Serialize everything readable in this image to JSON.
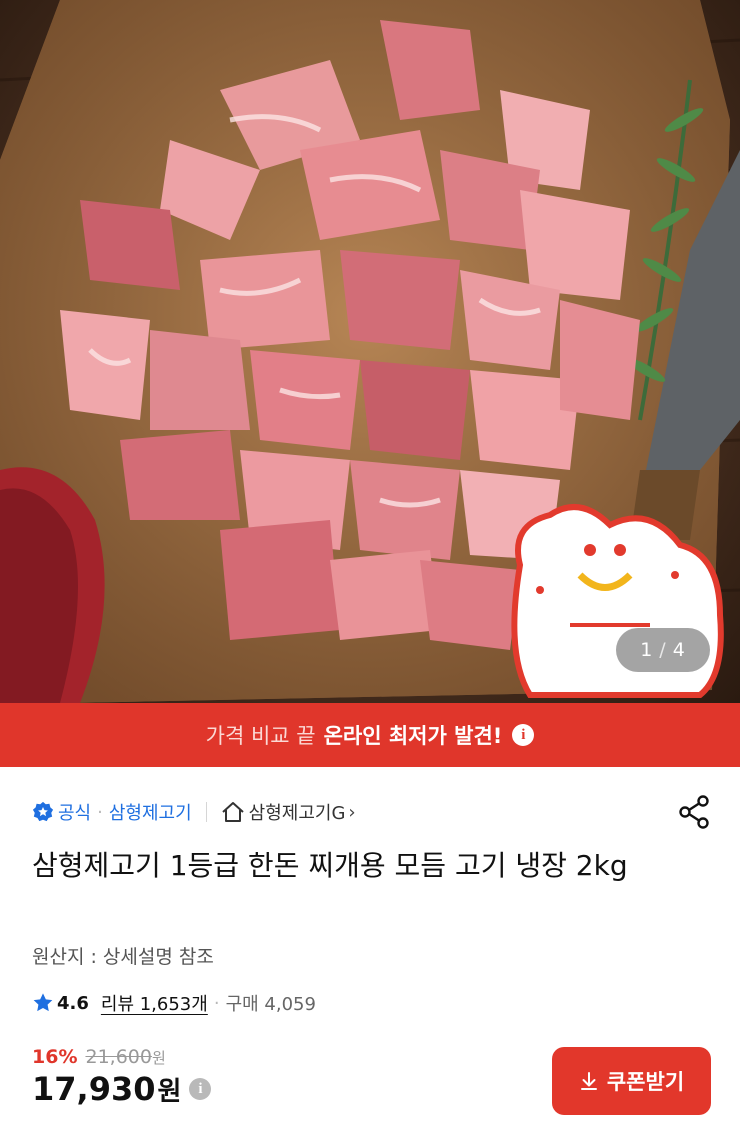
{
  "hero": {
    "pager_current": "1",
    "pager_separator": "/",
    "pager_total": "4"
  },
  "promo": {
    "lead": "가격 비교 끝",
    "highlight": "온라인 최저가 발견!",
    "info_glyph": "i"
  },
  "seller": {
    "official_label": "공식",
    "separator": "·",
    "brand": "삼형제고기",
    "store_name": "삼형제고기G",
    "store_chevron": "›"
  },
  "product": {
    "title": "삼형제고기 1등급 한돈 찌개용 모듬 고기 냉장 2kg",
    "origin": "원산지 : 상세설명 참조"
  },
  "rating": {
    "score": "4.6",
    "review_label": "리뷰 1,653개",
    "separator": "·",
    "sales_label": "구매 4,059"
  },
  "price": {
    "discount_rate": "16%",
    "original_price": "21,600",
    "original_unit": "원",
    "final_price": "17,930",
    "final_unit": "원",
    "info_glyph": "i"
  },
  "coupon": {
    "label": "쿠폰받기"
  },
  "colors": {
    "accent_red": "#e0362b",
    "link_blue": "#1f6fe0"
  },
  "icons": {
    "official": "shield-check-icon",
    "store": "home-icon",
    "share": "share-icon",
    "rating": "star-icon",
    "coupon": "download-icon"
  }
}
